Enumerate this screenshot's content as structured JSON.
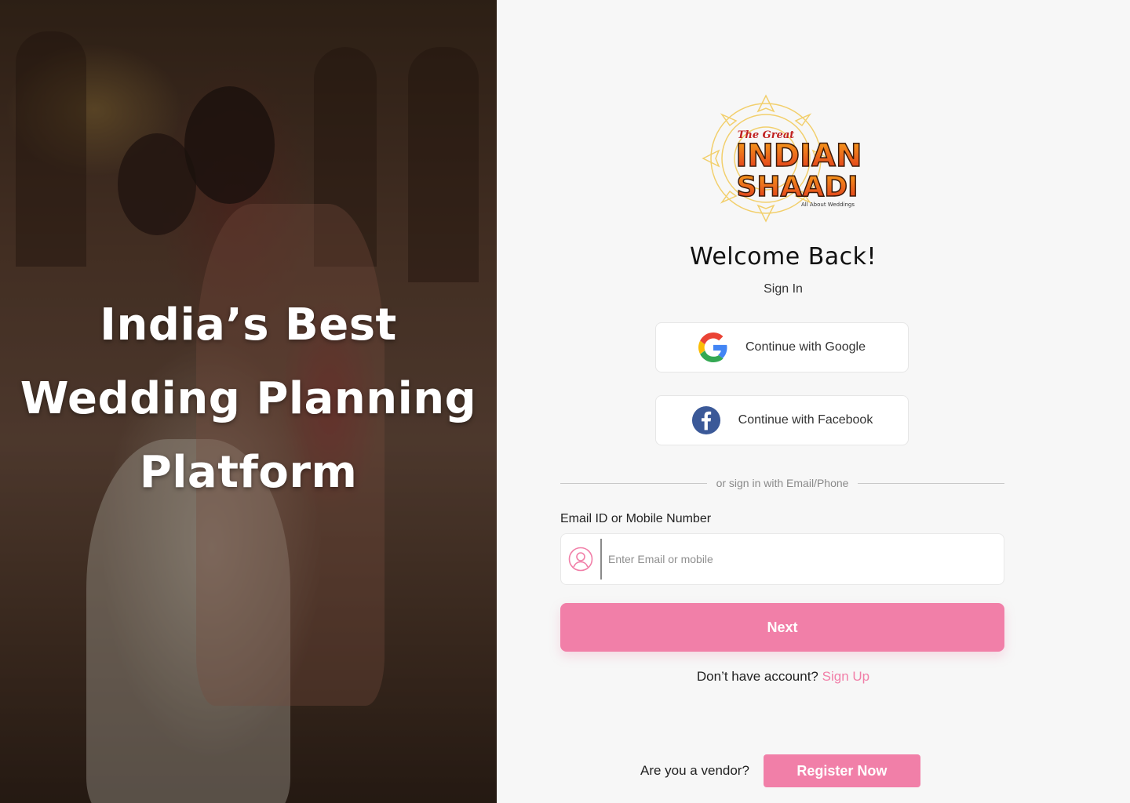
{
  "hero": {
    "title_lines": [
      "India’s Best",
      "Wedding Planning",
      "Platform"
    ]
  },
  "logo": {
    "line1": "The Great",
    "line2": "INDIAN",
    "line3": "SHAADI",
    "tagline": "All About Weddings"
  },
  "auth": {
    "title": "Welcome  Back!",
    "subtitle": "Sign In",
    "google_label": "Continue with Google",
    "facebook_label": "Continue with Facebook",
    "divider_text": "or sign in with Email/Phone",
    "field_label": "Email ID or Mobile Number",
    "input_placeholder": "Enter Email or mobile",
    "input_value": "",
    "next_label": "Next",
    "no_account_text": "Don’t have account?",
    "signup_link": "Sign Up"
  },
  "vendor": {
    "question": "Are you a vendor?",
    "register_label": "Register Now"
  },
  "colors": {
    "accent": "#f17fa8",
    "background": "#f7f7f7",
    "facebook": "#3b5998"
  }
}
